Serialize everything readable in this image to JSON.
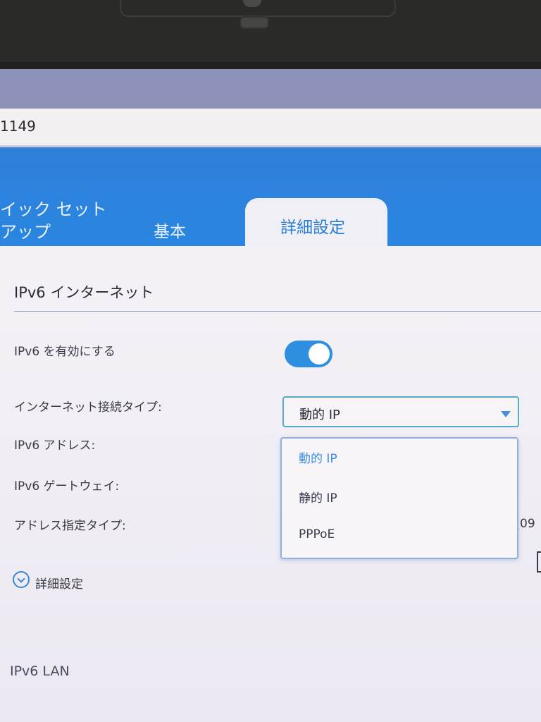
{
  "browser": {
    "address_fragment": "1149"
  },
  "header": {
    "tabs": [
      {
        "label": "イック セット\nアップ"
      },
      {
        "label": "基本"
      },
      {
        "label": "詳細設定",
        "active": true
      }
    ]
  },
  "section": {
    "title": "IPv6 インターネット"
  },
  "form": {
    "enable_label": "IPv6 を有効にする",
    "enable_state": true,
    "conn_type_label": "インターネット接続タイプ:",
    "conn_type_value": "動的 IP",
    "ipv6_address_label": "IPv6 アドレス:",
    "ipv6_gateway_label": "IPv6 ゲートウェイ:",
    "addr_assign_label": "アドレス指定タイプ:",
    "peek_value": "09"
  },
  "dropdown": {
    "options": [
      "動的 IP",
      "静的 IP",
      "PPPoE"
    ],
    "selected_index": 0
  },
  "advanced": {
    "label": "詳細設定"
  },
  "lan": {
    "title": "IPv6 LAN"
  },
  "colors": {
    "header_blue": "#2e7fd9",
    "accent_blue": "#3b8be0",
    "toggle_on": "#2e8fe0"
  }
}
